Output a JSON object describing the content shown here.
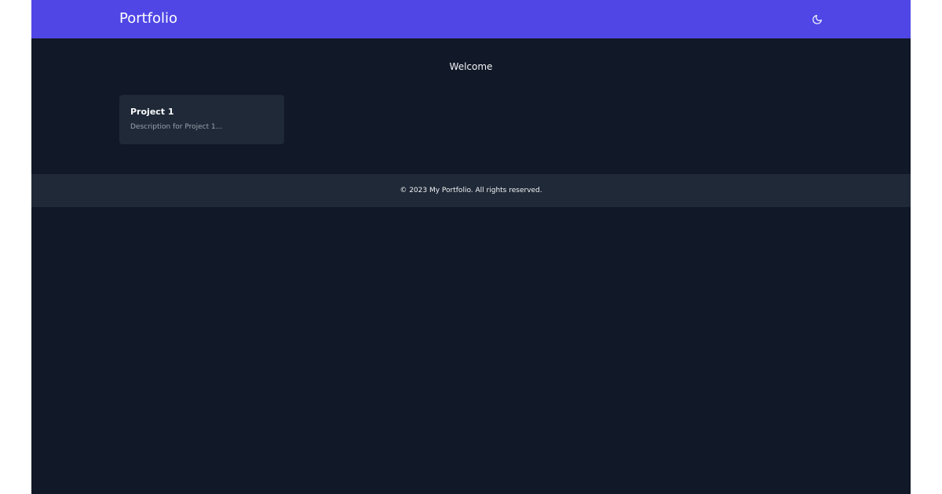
{
  "header": {
    "brand": "Portfolio",
    "theme_toggle_icon": "moon-icon"
  },
  "main": {
    "welcome": "Welcome",
    "projects": [
      {
        "title": "Project 1",
        "description": "Description for Project 1..."
      }
    ]
  },
  "footer": {
    "text": "© 2023 My Portfolio. All rights reserved."
  },
  "colors": {
    "header_bg": "#4f46e5",
    "page_bg": "#111827",
    "card_bg": "#1f2937",
    "footer_bg": "#1f2937",
    "outer_bg": "#ffffff"
  }
}
